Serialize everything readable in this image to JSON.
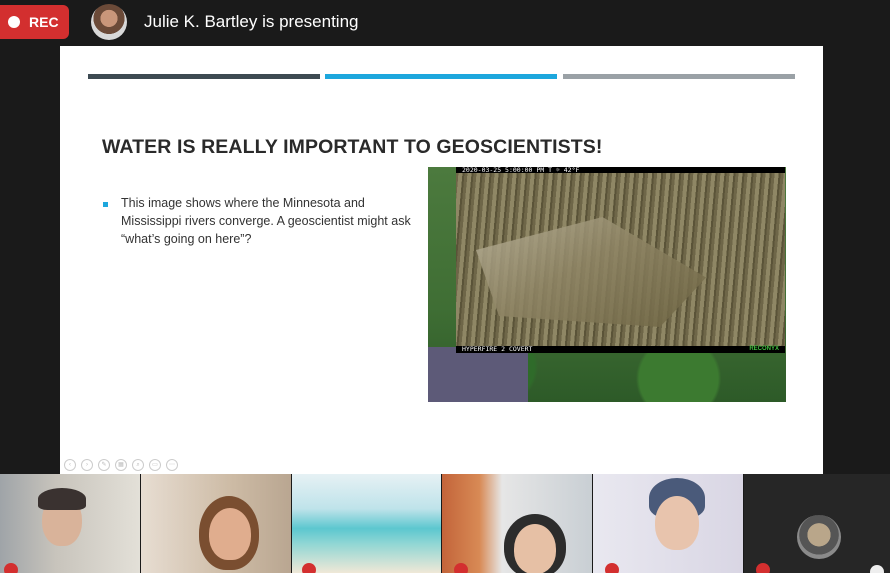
{
  "topbar": {
    "rec_label": "REC",
    "presenter_text": "Julie K. Bartley is presenting"
  },
  "slide": {
    "title": "WATER IS REALLY IMPORTANT TO GEOSCIENTISTS!",
    "bullet": "This image shows where the Minnesota and Mississippi rivers converge. A geoscientist might ask “what’s going on here”?",
    "camera_overlay_top": "2020-03-25  5:00:00 PM  T                               ☼  42°F",
    "camera_overlay_bottom": "HYPERFIRE 2 COVERT",
    "camera_brand": "RECONYX"
  },
  "colors": {
    "rec": "#d32f2f",
    "accent_blue": "#1da7dd",
    "bar_dark": "#3d4a52",
    "bar_grey": "#9aa1a6"
  },
  "participants": [
    {
      "name": "participant-1"
    },
    {
      "name": "participant-2"
    },
    {
      "name": "participant-3"
    },
    {
      "name": "participant-4"
    },
    {
      "name": "participant-5"
    },
    {
      "name": "participant-6"
    }
  ]
}
